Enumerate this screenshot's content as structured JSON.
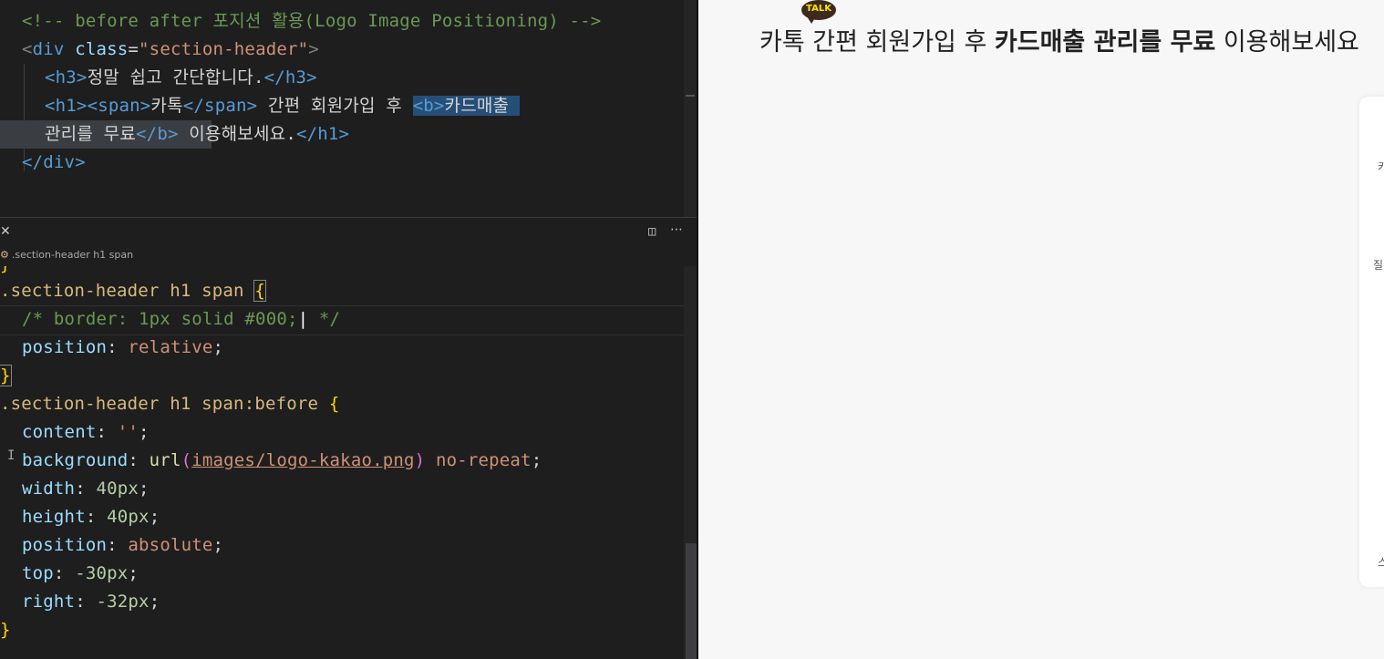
{
  "editor_top": {
    "comment": "<!-- before after 포지션 활용(Logo Image Positioning) -->",
    "div_open_lt": "<",
    "div_tag": "div",
    "div_attr": " class",
    "div_eq": "=",
    "div_str": "\"section-header\"",
    "div_gt": ">",
    "h3_open": "<h3>",
    "h3_text": "정말 쉽고 간단합니다.",
    "h3_close": "</h3>",
    "h1_open": "<h1>",
    "span_open": "<span>",
    "span_text": "카톡",
    "span_close": "</span>",
    "h1_mid_text": " 간편 회원가입 후 ",
    "b_open": "<b>",
    "b_text1": "카드매출 ",
    "b_text2": "관리를 무료",
    "b_close": "</b>",
    "h1_tail_text": " 이용해보세요.",
    "h1_close": "</h1>",
    "div_close": "</div>"
  },
  "breadcrumb": {
    "icon": "css-selector-icon",
    "path": ".section-header h1 span"
  },
  "editor_bottom": {
    "brace_stub": "}",
    "rule1_selector": ".section-header h1 span ",
    "rule1_open": "{",
    "rule1_comment": "/* border: 1px solid #000;",
    "rule1_comment_end": " */",
    "rule1_prop": "position",
    "rule1_val": "relative",
    "rule1_close": "}",
    "rule2_selector": ".section-header h1 span:before ",
    "rule2_open": "{",
    "content_prop": "content",
    "content_val": "''",
    "bg_prop": "background",
    "bg_fn": "url",
    "bg_url": "images/logo-kakao.png",
    "bg_rest": "no-repeat",
    "width_prop": "width",
    "width_val": "40px",
    "height_prop": "height",
    "height_val": "40px",
    "pos_prop": "position",
    "pos_val": "absolute",
    "top_prop": "top",
    "top_val": "-30px",
    "right_prop": "right",
    "right_val": "-32px",
    "rule2_close": "}"
  },
  "preview": {
    "talk_badge": "TALK",
    "title_part1": "카톡 간편 회원가입 후 ",
    "title_bold": "카드매출 관리를 무료",
    "title_part2": " 이용해보세요",
    "card_frag1": "카",
    "card_frag2": "질",
    "card_frag3": "스"
  }
}
